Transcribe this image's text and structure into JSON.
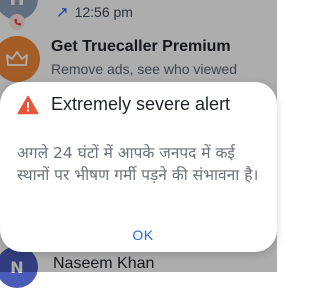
{
  "call_log": {
    "top_entry": {
      "avatar_letter": "H",
      "time": "12:56 pm",
      "direction_icon": "outgoing-arrow-icon"
    },
    "promo": {
      "title": "Get Truecaller Premium",
      "subtitle": "Remove ads, see who viewed",
      "icon": "crown-icon"
    },
    "bottom_entry": {
      "avatar_letter": "N",
      "name": "Naseem Khan"
    }
  },
  "alert": {
    "icon": "warning-triangle-icon",
    "title": "Extremely severe alert",
    "message": "अगले 24 घंटों में आपके जनपद में कई स्थानों पर भीषण गर्मी पड़ने की संभावना है।",
    "ok_label": "OK"
  },
  "colors": {
    "accent": "#1e6ad6",
    "warning": "#e8543a",
    "promo_avatar": "#f28a3a",
    "contact_avatar": "#4a5bb8"
  }
}
